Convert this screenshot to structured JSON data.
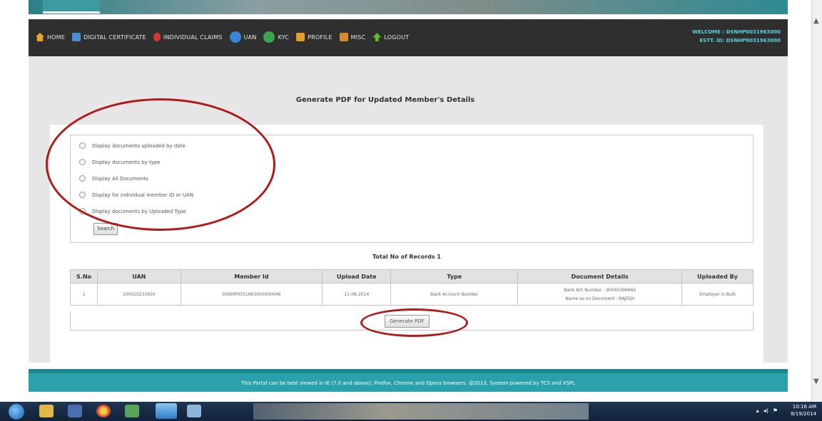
{
  "topbar": {
    "right_text": ""
  },
  "nav": {
    "items": [
      {
        "label": "HOME",
        "icon": "home-icon"
      },
      {
        "label": "DIGITAL CERTIFICATE",
        "icon": "certificate-icon"
      },
      {
        "label": "INDIVIDUAL CLAIMS",
        "icon": "person-icon"
      },
      {
        "label": "UAN",
        "icon": "uan-icon"
      },
      {
        "label": "KYC",
        "icon": "kyc-icon"
      },
      {
        "label": "PROFILE",
        "icon": "profile-icon"
      },
      {
        "label": "MISC",
        "icon": "misc-icon"
      },
      {
        "label": "LOGOUT",
        "icon": "logout-icon"
      }
    ],
    "welcome_line1": "WELCOME : DSNHP0031963000",
    "welcome_line2": "ESTT. ID: DSNHP0031963000"
  },
  "page": {
    "title": "Generate PDF for Updated Member's Details"
  },
  "options": [
    "Display documents uploaded by date",
    "Display documents by type",
    "Display All Documents",
    "Display for individual member ID or UAN",
    "Display documents by Uploaded Type"
  ],
  "search_label": "Search",
  "records_label": "Total No of Records 1",
  "table": {
    "headers": [
      "S.No",
      "UAN",
      "Member Id",
      "Upload Date",
      "Type",
      "Document Details",
      "Uploaded By"
    ],
    "rows": [
      {
        "sno": "1",
        "uan": "100010233920",
        "member_id": "DSNHP0031963000000046",
        "upload_date": "11-08-2014",
        "type": "Bank Account Number",
        "details_line1": "Bank A/C Number : 90045396682",
        "details_line2": "Name as on Document : RAJESH",
        "uploaded_by": "Employer in Bulk"
      }
    ]
  },
  "generate_label": "Generate PDF",
  "footer": {
    "text": "This Portal can be best viewed in IE (7.0 and above), Firefox, Chrome and Opera browsers.     @2013, System powered by TCS and VSPL"
  },
  "taskbar": {
    "time": "10:16 AM",
    "date": "8/19/2014"
  },
  "colors": {
    "teal": "#2aa1ab",
    "navbar": "#2f2f2f",
    "annotation": "#b01a1a"
  }
}
